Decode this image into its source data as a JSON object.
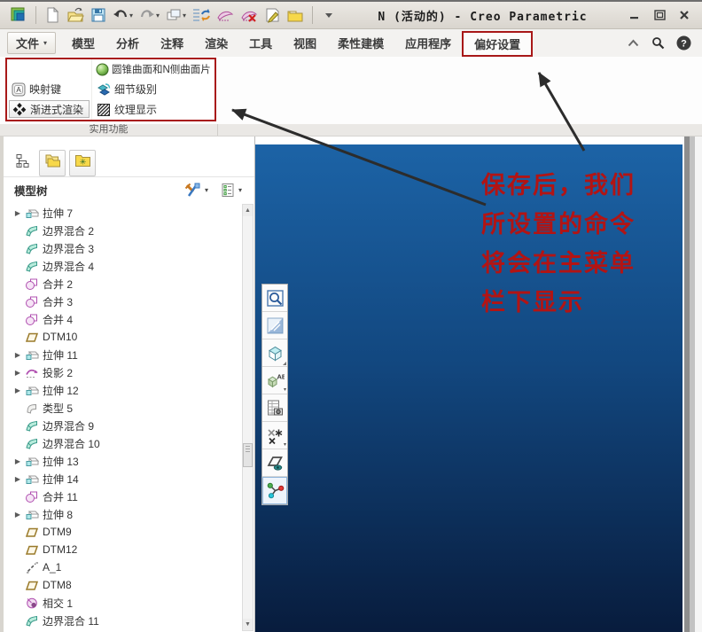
{
  "titlebar": {
    "title": "N (活动的) - Creo Parametric",
    "quick_access": [
      {
        "name": "creo-logo-icon"
      },
      {
        "name": "separator"
      },
      {
        "name": "new-file-icon"
      },
      {
        "name": "open-file-icon"
      },
      {
        "name": "save-icon"
      },
      {
        "name": "undo-icon",
        "dropdown": true
      },
      {
        "name": "redo-icon",
        "dropdown": true
      },
      {
        "name": "windows-icon",
        "dropdown": true
      },
      {
        "name": "regenerate-icon"
      },
      {
        "name": "mapkey-record-icon"
      },
      {
        "name": "mapkey-stop-icon"
      },
      {
        "name": "edit-note-icon"
      },
      {
        "name": "active-window-icon"
      },
      {
        "name": "separator"
      },
      {
        "name": "toolbar-overflow-icon"
      }
    ],
    "window_controls": [
      {
        "name": "minimize"
      },
      {
        "name": "restore"
      },
      {
        "name": "close"
      }
    ]
  },
  "menubar": {
    "tabs": [
      {
        "label": "文件",
        "file": true
      },
      {
        "label": "模型"
      },
      {
        "label": "分析"
      },
      {
        "label": "注释"
      },
      {
        "label": "渲染"
      },
      {
        "label": "工具"
      },
      {
        "label": "视图"
      },
      {
        "label": "柔性建模"
      },
      {
        "label": "应用程序"
      },
      {
        "label": "偏好设置",
        "highlighted": true
      }
    ],
    "right_icons": [
      {
        "name": "collapse-ribbon-icon"
      },
      {
        "name": "search-icon"
      },
      {
        "name": "help-icon"
      }
    ]
  },
  "ribbon": {
    "group_label": "实用功能",
    "commands": {
      "conic": {
        "label": "圆锥曲面和N侧曲面片",
        "icon": "conic-sphere-icon"
      },
      "mapkey": {
        "label": "映射键",
        "icon": "mapkey-icon"
      },
      "detail": {
        "label": "细节级别",
        "icon": "detail-level-icon"
      },
      "progressive": {
        "label": "渐进式渲染",
        "icon": "progressive-render-icon"
      },
      "texture": {
        "label": "纹理显示",
        "icon": "texture-display-icon"
      }
    }
  },
  "left_panel": {
    "tabs": [
      {
        "name": "model-tree-tab",
        "icon": "tree-tab-icon",
        "active": true
      },
      {
        "name": "folder-browser-tab",
        "icon": "folders-tab-icon"
      },
      {
        "name": "favorites-tab",
        "icon": "star-folder-tab-icon"
      }
    ],
    "header": {
      "title": "模型树",
      "icons": [
        {
          "name": "tree-tools-icon",
          "dropdown": true
        },
        {
          "name": "tree-filter-icon",
          "dropdown": true
        }
      ]
    },
    "tree": [
      {
        "icon": "extrude-icon",
        "label": "拉伸 7",
        "expandable": true
      },
      {
        "icon": "boundary-blend-icon",
        "label": "边界混合 2"
      },
      {
        "icon": "boundary-blend-icon",
        "label": "边界混合 3"
      },
      {
        "icon": "boundary-blend-icon",
        "label": "边界混合 4"
      },
      {
        "icon": "merge-icon",
        "label": "合并 2"
      },
      {
        "icon": "merge-icon",
        "label": "合并 3"
      },
      {
        "icon": "merge-icon",
        "label": "合并 4"
      },
      {
        "icon": "datum-plane-icon",
        "label": "DTM10"
      },
      {
        "icon": "extrude-icon",
        "label": "拉伸 11",
        "expandable": true
      },
      {
        "icon": "project-icon",
        "label": "投影 2",
        "expandable": true
      },
      {
        "icon": "extrude-icon",
        "label": "拉伸 12",
        "expandable": true
      },
      {
        "icon": "style-icon",
        "label": "类型 5"
      },
      {
        "icon": "boundary-blend-icon",
        "label": "边界混合 9"
      },
      {
        "icon": "boundary-blend-icon",
        "label": "边界混合 10"
      },
      {
        "icon": "extrude-icon",
        "label": "拉伸 13",
        "expandable": true
      },
      {
        "icon": "extrude-icon",
        "label": "拉伸 14",
        "expandable": true
      },
      {
        "icon": "merge-icon",
        "label": "合并 11"
      },
      {
        "icon": "extrude-icon",
        "label": "拉伸 8",
        "expandable": true
      },
      {
        "icon": "datum-plane-icon",
        "label": "DTM9"
      },
      {
        "icon": "datum-plane-icon",
        "label": "DTM12"
      },
      {
        "icon": "axis-icon",
        "label": "A_1"
      },
      {
        "icon": "datum-plane-icon",
        "label": "DTM8"
      },
      {
        "icon": "intersect-icon",
        "label": "相交 1"
      },
      {
        "icon": "boundary-blend-icon",
        "label": "边界混合 11"
      }
    ]
  },
  "viewport": {
    "toolbar": [
      {
        "name": "zoom-in-icon"
      },
      {
        "name": "repaint-icon"
      },
      {
        "name": "named-views-icon",
        "corner": true
      },
      {
        "name": "appearances-icon",
        "dropdown": true
      },
      {
        "name": "view-manager-icon"
      },
      {
        "name": "datum-display-icon",
        "dropdown": true
      },
      {
        "name": "plane-display-icon"
      },
      {
        "name": "csys-display-icon",
        "selected": true
      }
    ],
    "annotation": {
      "lines": [
        "保存后，我们",
        "所设置的命令",
        "将会在主菜单",
        "栏下显示"
      ],
      "color": "#b21414"
    },
    "background_top": "#1c63a6",
    "background_mid": "#12477f",
    "background_bottom": "#081c3d"
  }
}
